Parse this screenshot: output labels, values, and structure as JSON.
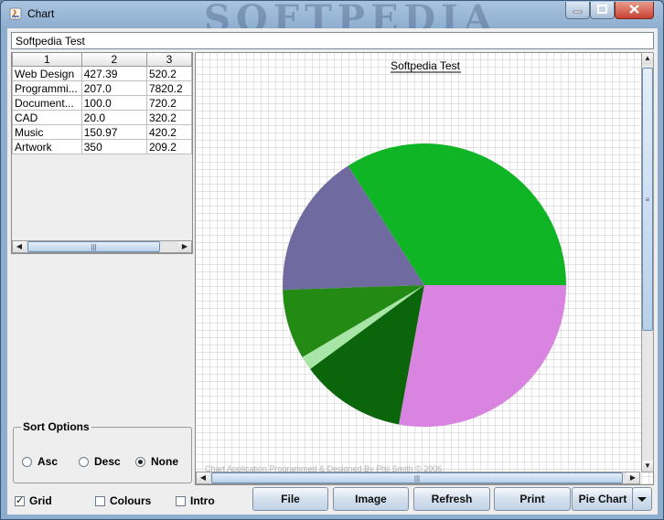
{
  "window": {
    "title": "Chart",
    "watermark": "SOFTPEDIA"
  },
  "title_field": {
    "value": "Softpedia Test"
  },
  "table": {
    "headers": [
      "1",
      "2",
      "3"
    ],
    "rows": [
      [
        "Web Design",
        "427.39",
        "520.2"
      ],
      [
        "Programmi...",
        "207.0",
        "7820.2"
      ],
      [
        "Document...",
        "100.0",
        "720.2"
      ],
      [
        "CAD",
        "20.0",
        "320.2"
      ],
      [
        "Music",
        "150.97",
        "420.2"
      ],
      [
        "Artwork",
        "350",
        "209.2"
      ]
    ]
  },
  "sort_options": {
    "title": "Sort Options",
    "options": [
      {
        "label": "Asc",
        "selected": false
      },
      {
        "label": "Desc",
        "selected": false
      },
      {
        "label": "None",
        "selected": true
      }
    ]
  },
  "chart_data": {
    "type": "pie",
    "title": "Softpedia Test",
    "footer": "Chart Application Programmed & Designed By Phil Smith © 2006",
    "grid": true,
    "categories": [
      "Web Design",
      "Programmi...",
      "Document...",
      "CAD",
      "Music",
      "Artwork"
    ],
    "values": [
      427.39,
      207.0,
      100.0,
      20.0,
      150.97,
      350
    ],
    "colors": [
      "#0fb524",
      "#6f6ba0",
      "#238a14",
      "#a8e6a8",
      "#0b660b",
      "#d884e0"
    ]
  },
  "options": {
    "grid": {
      "label": "Grid",
      "checked": true
    },
    "colours": {
      "label": "Colours",
      "checked": false
    },
    "intro": {
      "label": "Intro",
      "checked": false
    }
  },
  "buttons": {
    "file": "File",
    "image": "Image",
    "refresh": "Refresh",
    "print": "Print",
    "chart_type": "Pie Chart"
  },
  "icons": {
    "app": "java-icon",
    "minimize": "minimize-icon",
    "maximize": "maximize-icon",
    "close": "close-icon",
    "dropdown": "chevron-down-icon"
  }
}
